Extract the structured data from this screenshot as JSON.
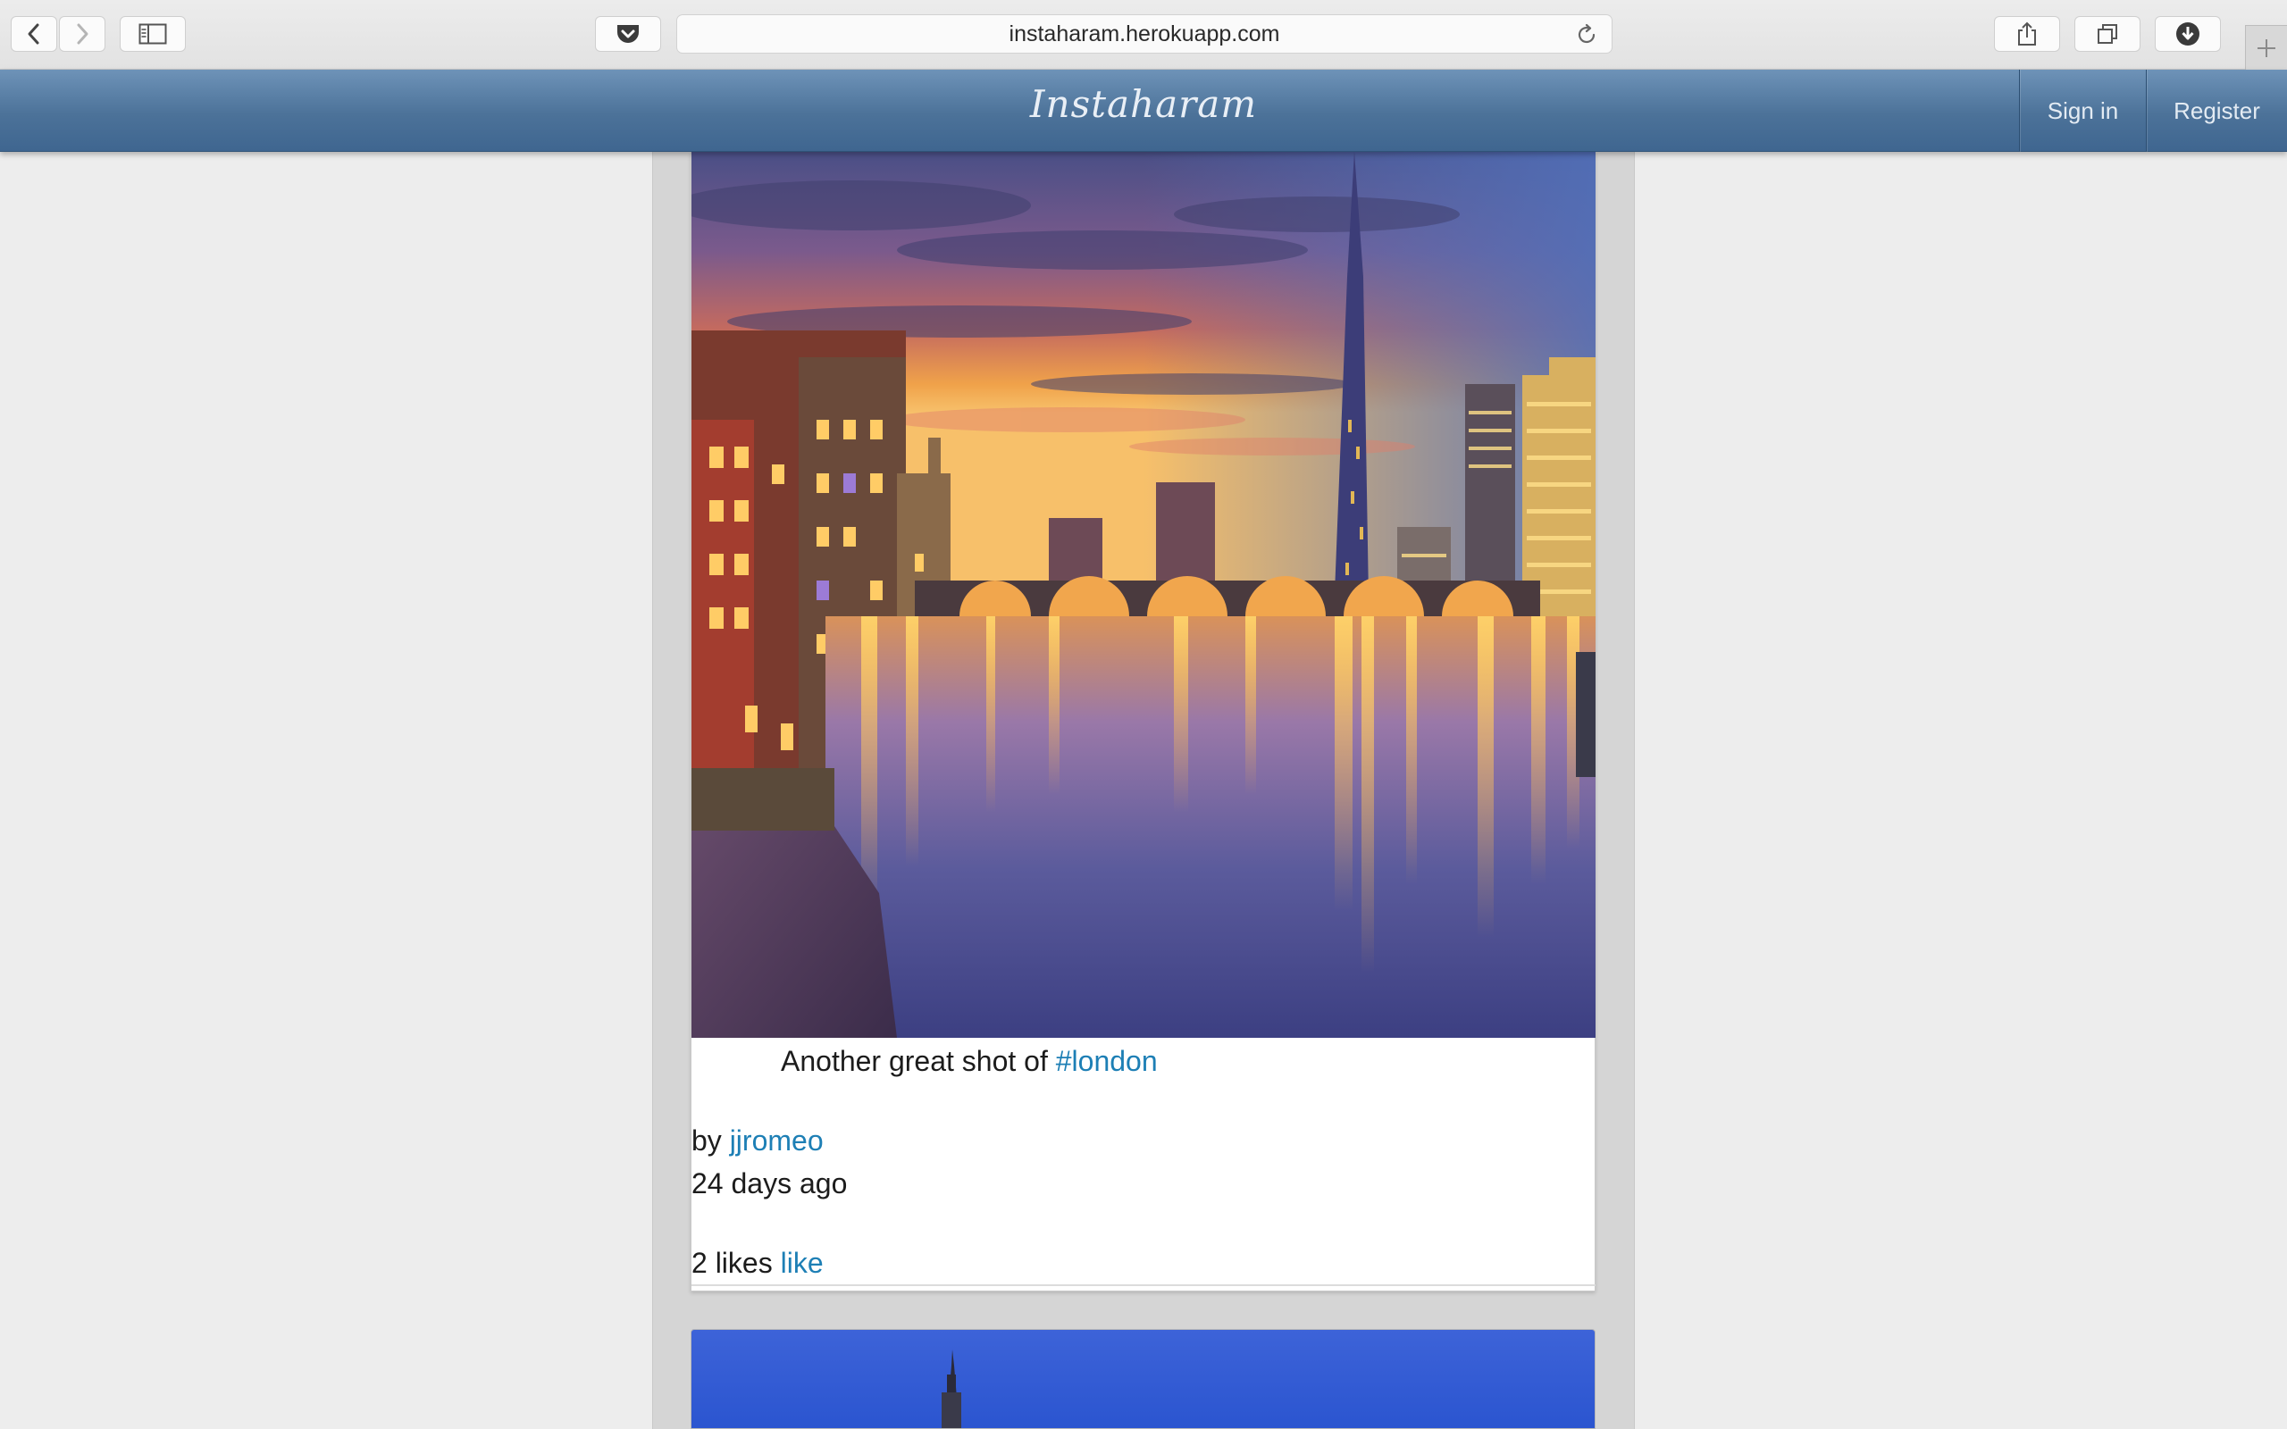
{
  "browser": {
    "url": "instaharam.herokuapp.com",
    "buttons": {
      "back": "back-arrow-icon",
      "forward": "forward-arrow-icon",
      "sidebar": "sidebar-icon",
      "pocket": "pocket-icon",
      "reload": "reload-icon",
      "share": "share-icon",
      "tabs": "tabs-overview-icon",
      "downloads": "download-icon",
      "new_tab": "plus-icon"
    }
  },
  "navbar": {
    "brand": "Instaharam",
    "sign_in": "Sign in",
    "register": "Register",
    "colors": {
      "bar_top": "#6e93b8",
      "bar_bottom": "#3f6690",
      "text": "#e3ebf3"
    }
  },
  "posts": [
    {
      "caption_text": "Another great shot of",
      "caption_tag": "#london",
      "by_label": "by",
      "author": "jjromeo",
      "time_ago": "24 days ago",
      "likes_text": "2 likes",
      "like_link": "like"
    }
  ],
  "colors": {
    "page_background": "#ededed",
    "column_background": "#d5d5d5",
    "link": "#1d7fb5",
    "text": "#1c1c1c"
  }
}
